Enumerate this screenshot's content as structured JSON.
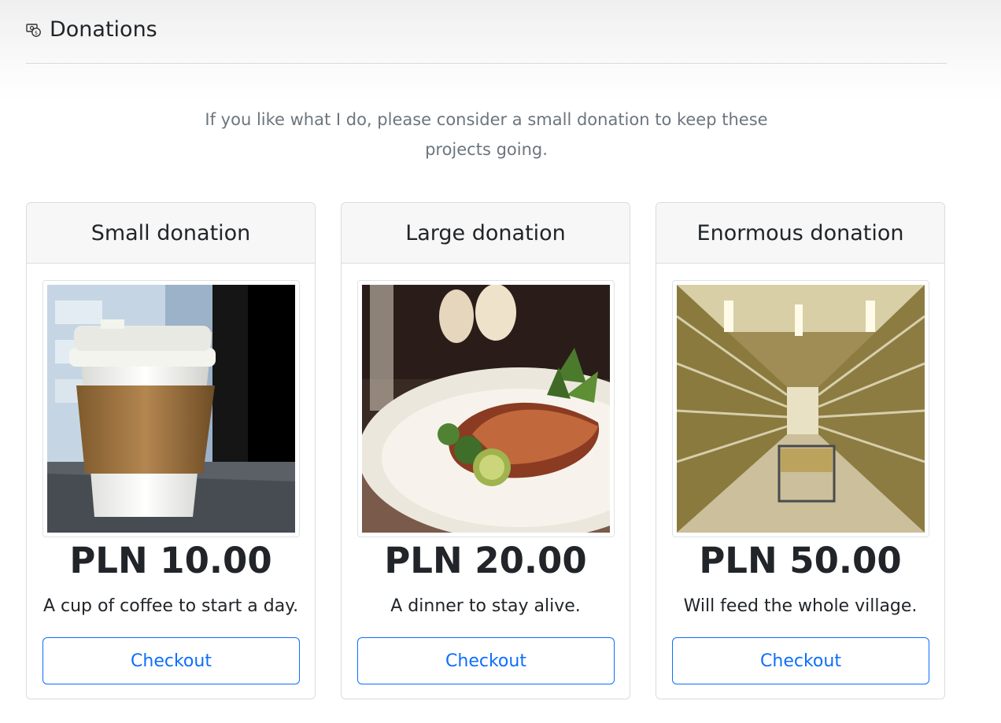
{
  "header": {
    "title": "Donations",
    "icon": "money-cash-icon"
  },
  "intro": "If you like what I do, please consider a small donation to keep these projects going.",
  "accent_color": "#0d6efd",
  "cards": [
    {
      "title": "Small donation",
      "image": "coffee-cup-photo",
      "price": "PLN 10.00",
      "description": "A cup of coffee to start a day.",
      "button_label": "Checkout"
    },
    {
      "title": "Large donation",
      "image": "dinner-plate-photo",
      "price": "PLN 20.00",
      "description": "A dinner to stay alive.",
      "button_label": "Checkout"
    },
    {
      "title": "Enormous donation",
      "image": "grocery-aisle-photo",
      "price": "PLN 50.00",
      "description": "Will feed the whole village.",
      "button_label": "Checkout"
    }
  ]
}
